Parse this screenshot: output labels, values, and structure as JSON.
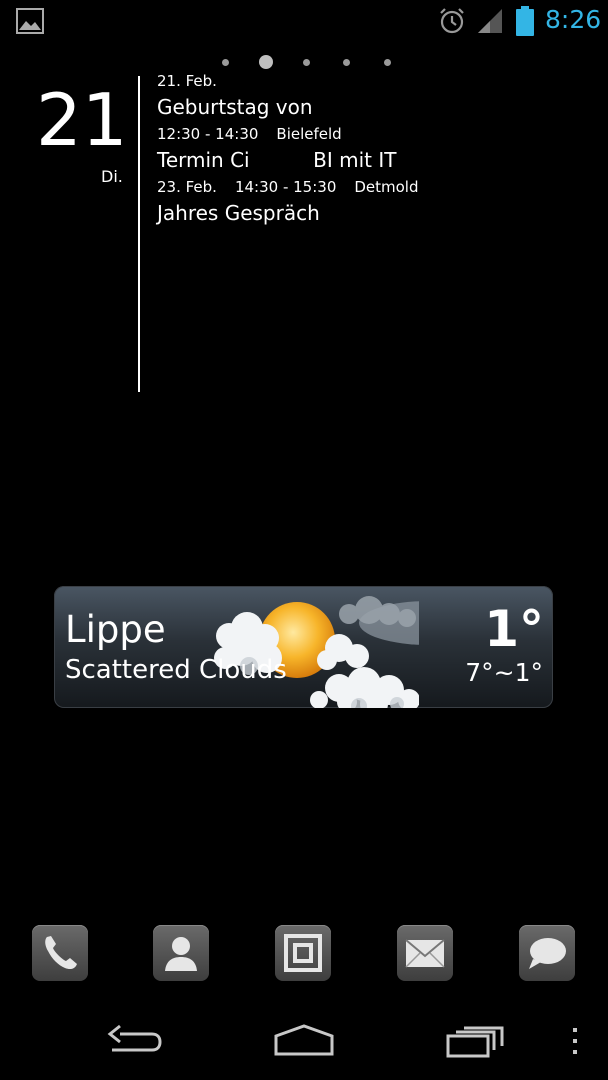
{
  "status_bar": {
    "time": "8:26",
    "icons": [
      "image-icon",
      "alarm-icon",
      "signal-icon",
      "battery-icon"
    ],
    "accent_color": "#33b5e5"
  },
  "page_indicator": {
    "pages": 5,
    "active_index": 1
  },
  "calendar": {
    "day": "21",
    "weekday": "Di.",
    "events": [
      {
        "type": "meta",
        "date": "21. Feb."
      },
      {
        "type": "title",
        "text": "Geburtstag von"
      },
      {
        "type": "meta",
        "time": "12:30 - 14:30",
        "place": "Bielefeld"
      },
      {
        "type": "title",
        "text": "Termin Ci          BI mit IT"
      },
      {
        "type": "meta",
        "date": "23. Feb.",
        "time": "14:30 - 15:30",
        "place": "Detmold"
      },
      {
        "type": "title",
        "text": "Jahres Gespräch"
      }
    ]
  },
  "weather": {
    "location": "Lippe",
    "condition": "Scattered Clouds",
    "temperature": "1°",
    "range": "7°~1°",
    "icon": "sun-cloud-icon"
  },
  "dock": [
    {
      "name": "phone",
      "icon": "phone-icon"
    },
    {
      "name": "contacts",
      "icon": "person-icon"
    },
    {
      "name": "apps",
      "icon": "apps-icon"
    },
    {
      "name": "email",
      "icon": "envelope-icon"
    },
    {
      "name": "messaging",
      "icon": "chat-bubble-icon"
    }
  ],
  "nav_bar": [
    "back-icon",
    "home-icon",
    "recents-icon",
    "overflow-menu-icon"
  ]
}
